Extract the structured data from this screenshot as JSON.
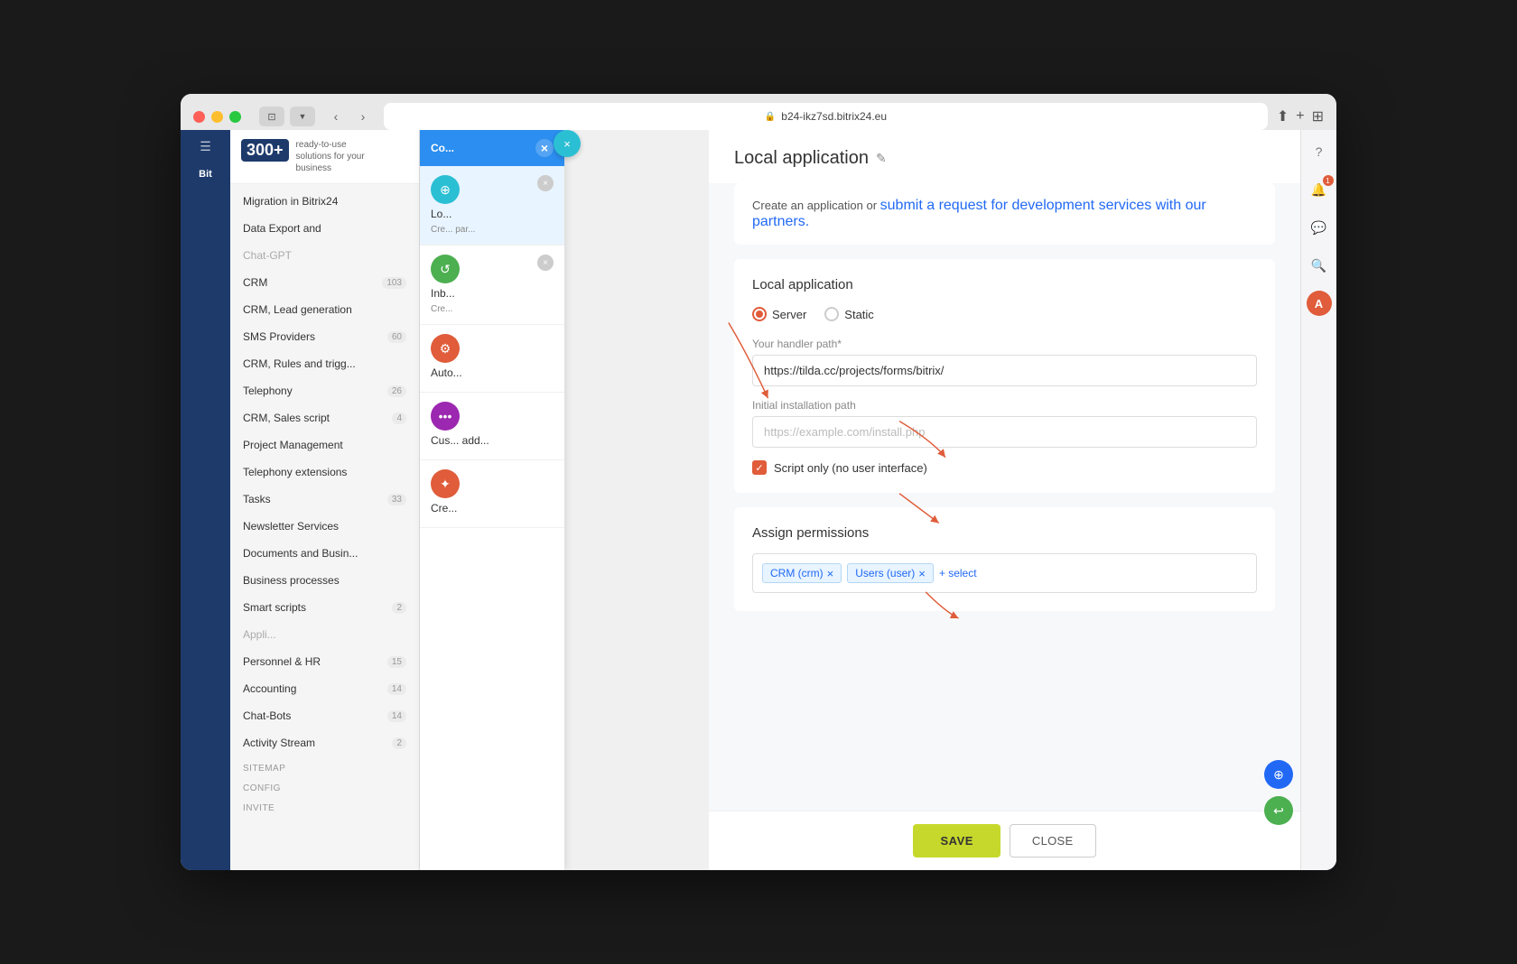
{
  "browser": {
    "url": "b24-ikz7sd.bitrix24.eu",
    "traffic_lights": [
      "red",
      "yellow",
      "green"
    ]
  },
  "sidebar": {
    "logo": "Bit",
    "menu_icon": "≡"
  },
  "marketplace": {
    "promo_badge": "300+",
    "promo_text1": "ready-to-use",
    "promo_text2": "solutions for your",
    "promo_text3": "business",
    "items": [
      {
        "label": "Migration in Bitrix24",
        "badge": ""
      },
      {
        "label": "Data Export and",
        "badge": ""
      },
      {
        "label": "Chat-GPT",
        "badge": ""
      },
      {
        "label": "CRM",
        "badge": "103"
      },
      {
        "label": "CRM, Lead generation",
        "badge": ""
      },
      {
        "label": "SMS Providers",
        "badge": "60"
      },
      {
        "label": "CRM, Rules and trigg...",
        "badge": ""
      },
      {
        "label": "Telephony",
        "badge": "26"
      },
      {
        "label": "CRM, Sales script",
        "badge": "4"
      },
      {
        "label": "Project Management",
        "badge": ""
      },
      {
        "label": "Telephony extensions",
        "badge": ""
      },
      {
        "label": "Tasks",
        "badge": "33"
      },
      {
        "label": "Newsletter Services",
        "badge": ""
      },
      {
        "label": "Documents and Busin...",
        "badge": ""
      },
      {
        "label": "Business processes",
        "badge": ""
      },
      {
        "label": "Smart scripts",
        "badge": "2"
      },
      {
        "label": "Personnel & HR",
        "badge": "15"
      },
      {
        "label": "Accounting",
        "badge": "14"
      },
      {
        "label": "Chat-Bots",
        "badge": "14"
      },
      {
        "label": "Activity Stream",
        "badge": "2"
      }
    ],
    "section_labels": [
      "SITEMAP",
      "CONFIG",
      "INVITE"
    ]
  },
  "slide_panel": {
    "header": "Co...",
    "close_x": "×",
    "items": [
      {
        "title": "Lo...",
        "desc": "Cre... par...",
        "icon_color": "#2bbfd4",
        "icon": "⊕"
      },
      {
        "title": "Inb...",
        "desc": "Cre...",
        "icon_color": "#4caf50",
        "icon": "↺"
      },
      {
        "title": "Auto...",
        "desc": "",
        "icon_color": "#e05c3a",
        "icon": "⚙"
      },
      {
        "title": "Cus... add...",
        "desc": "",
        "icon_color": "#9c27b0",
        "icon": "•••"
      },
      {
        "title": "Cre...",
        "desc": "",
        "icon_color": "#e05c3a",
        "icon": "✦"
      }
    ]
  },
  "overlay_close_btn": "×",
  "dialog": {
    "title": "Local application",
    "edit_icon": "✎",
    "info_text": "Create an application or ",
    "info_link": "submit a request for development services with our partners.",
    "form_title": "Local application",
    "radio_server": "Server",
    "radio_static": "Static",
    "handler_label": "Your handler path*",
    "handler_value": "https://tilda.cc/projects/forms/bitrix/",
    "install_label": "Initial installation path",
    "install_placeholder": "https://example.com/install.php",
    "checkbox_label": "Script only (no user interface)",
    "permissions_title": "Assign permissions",
    "permission_tags": [
      {
        "label": "CRM (crm)",
        "removable": true
      },
      {
        "label": "Users (user)",
        "removable": true
      }
    ],
    "add_permission": "+ select",
    "save_btn": "SAVE",
    "close_btn": "CLOSE"
  },
  "right_bar": {
    "icons": [
      "?",
      "🔔",
      "💬",
      "🔍"
    ],
    "avatar": "A",
    "notification_count": "1"
  },
  "bottom_fabs": [
    {
      "icon": "⊕",
      "color": "#2169f5"
    },
    {
      "icon": "↩",
      "color": "#4caf50"
    }
  ]
}
